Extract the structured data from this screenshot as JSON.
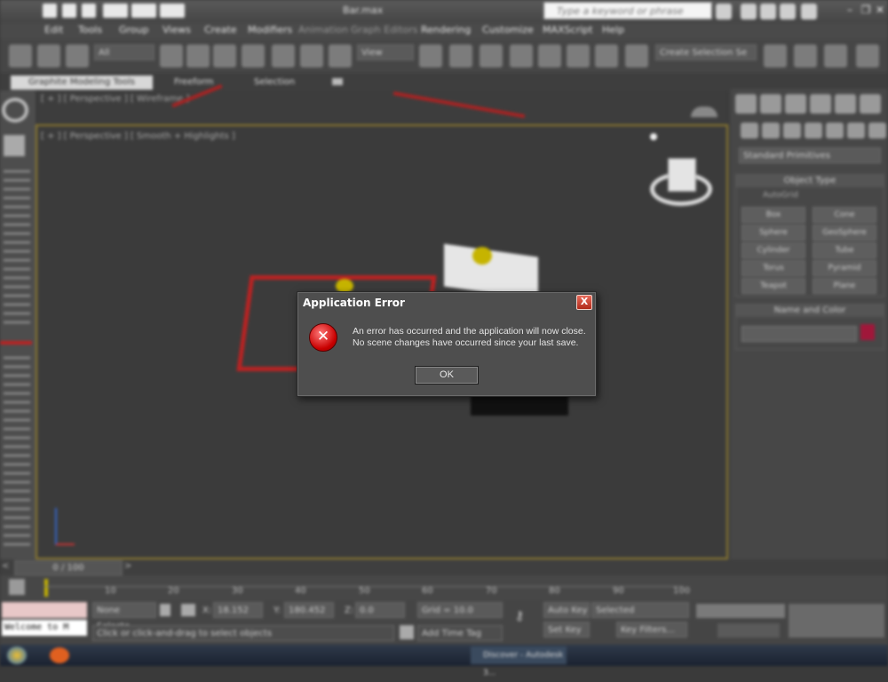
{
  "window": {
    "title": "Bar.max"
  },
  "search": {
    "placeholder": "Type a keyword or phrase"
  },
  "menu": [
    "Edit",
    "Tools",
    "Group",
    "Views",
    "Create",
    "Modifiers",
    "Animation",
    "Graph Editors",
    "Rendering",
    "Customize",
    "MAXScript",
    "Help"
  ],
  "toolbar": {
    "selection_filter": "All",
    "ref_coord": "View",
    "named_selection": "Create Selection Se"
  },
  "ribbon": {
    "tabs": [
      "Graphite Modeling Tools",
      "Freeform",
      "Selection"
    ]
  },
  "viewports": {
    "top_label": "[ + ] [ Perspective ] [ Wireframe ]",
    "main_label": "[ + ] [ Perspective ] [ Smooth + Highlights ]"
  },
  "command_panel": {
    "category": "Standard Primitives",
    "object_type_title": "Object Type",
    "autogrid": "AutoGrid",
    "buttons": [
      "Box",
      "Cone",
      "Sphere",
      "GeoSphere",
      "Cylinder",
      "Tube",
      "Torus",
      "Pyramid",
      "Teapot",
      "Plane"
    ],
    "name_color_title": "Name and Color",
    "color": "#a0173a"
  },
  "timeline": {
    "frame": "0 / 100",
    "ticks": [
      "10",
      "20",
      "30",
      "40",
      "50",
      "60",
      "70",
      "80",
      "90",
      "100"
    ]
  },
  "status": {
    "maxscript": "Welcome to M",
    "selection": "None Selecte",
    "x_label": "X:",
    "x_value": "18.152",
    "y_label": "Y:",
    "y_value": "180.452",
    "z_label": "Z:",
    "z_value": "0.0",
    "grid": "Grid = 10.0",
    "prompt": "Click or click-and-drag to select objects",
    "add_time_tag": "Add Time Tag",
    "auto_key": "Auto Key",
    "set_key": "Set Key",
    "key_mode": "Selected",
    "key_filters": "Key Filters..."
  },
  "taskbar": {
    "task": "Discover - Autodesk 3..."
  },
  "dialog": {
    "title": "Application Error",
    "message_line1": "An error has occurred and the application will now close.",
    "message_line2": "No scene changes have occurred since your last save.",
    "ok_label": "OK",
    "close_glyph": "X",
    "icon": "error-icon"
  }
}
